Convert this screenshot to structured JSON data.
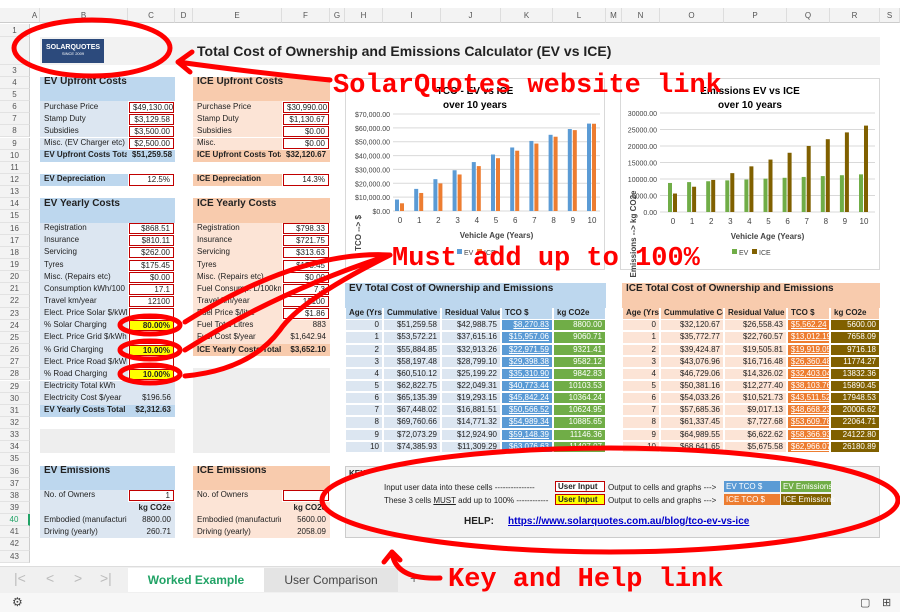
{
  "columns": [
    "A",
    "B",
    "C",
    "D",
    "E",
    "F",
    "G",
    "H",
    "I",
    "J",
    "K",
    "L",
    "M",
    "N",
    "O",
    "P",
    "Q",
    "R",
    "S"
  ],
  "logo": {
    "text": "SOLARQUOTES",
    "sub": "SINCE 2009"
  },
  "page_title": "Total Cost of Ownership and Emissions Calculator (EV vs ICE)",
  "colors": {
    "input_border": "#c00000",
    "must_sum": "#ffff00",
    "ev_tco": "#5b9bd5",
    "ev_emissions": "#70ad47",
    "ice_tco": "#ed7d31",
    "ice_emissions": "#806000",
    "ev_section": "#dce6f1",
    "ice_section": "#fce4d6",
    "annotation": "#ff0000"
  },
  "ev": {
    "upfront_title": "EV Upfront Costs",
    "upfront": [
      {
        "label": "Purchase Price",
        "value": "$49,130.00"
      },
      {
        "label": "Stamp Duty",
        "value": "$3,129.58"
      },
      {
        "label": "Subsidies",
        "value": "$3,500.00"
      },
      {
        "label": "Misc. (EV Charger etc)",
        "value": "$2,500.00"
      }
    ],
    "upfront_total": {
      "label": "EV Upfront Costs Total",
      "value": "$51,259.58"
    },
    "depreciation": {
      "label": "EV Depreciation",
      "value": "12.5%"
    },
    "yearly_title": "EV Yearly Costs",
    "yearly": [
      {
        "label": "Registration",
        "value": "$868.51",
        "t": "inp"
      },
      {
        "label": "Insurance",
        "value": "$810.11",
        "t": "inp"
      },
      {
        "label": "Servicing",
        "value": "$262.00",
        "t": "inp"
      },
      {
        "label": "Tyres",
        "value": "$175.45",
        "t": "inp"
      },
      {
        "label": "Misc. (Repairs etc)",
        "value": "$0.00",
        "t": "inp"
      },
      {
        "label": "Consumption kWh/100",
        "value": "17.1",
        "t": "inp"
      },
      {
        "label": "Travel km/year",
        "value": "12100",
        "t": "inp"
      },
      {
        "label": "Elect. Price Solar $/kWh",
        "value": "",
        "t": "inp"
      },
      {
        "label": "% Solar Charging",
        "value": "80.00%",
        "t": "yel"
      },
      {
        "label": "Elect. Price Grid $/kWh",
        "value": "",
        "t": "inp"
      },
      {
        "label": "% Grid Charging",
        "value": "10.00%",
        "t": "yel"
      },
      {
        "label": "Elect. Price Road $/kWh",
        "value": "",
        "t": "inp"
      },
      {
        "label": "% Road Charging",
        "value": "10.00%",
        "t": "yel"
      },
      {
        "label": "Electricity Total kWh",
        "value": "",
        "t": "out"
      },
      {
        "label": "Electricity Cost $/year",
        "value": "$196.56",
        "t": "out"
      }
    ],
    "yearly_total": {
      "label": "EV Yearly Costs Total",
      "value": "$2,312.63"
    },
    "emissions_title": "EV Emissions",
    "owners": {
      "label": "No. of Owners",
      "value": "1"
    },
    "unit": "kg CO2e",
    "emissions": [
      {
        "label": "Embodied (manufacturing)",
        "value": "8800.00"
      },
      {
        "label": "Driving (yearly)",
        "value": "260.71"
      }
    ]
  },
  "ice": {
    "upfront_title": "ICE Upfront Costs",
    "upfront": [
      {
        "label": "Purchase Price",
        "value": "$30,990.00"
      },
      {
        "label": "Stamp Duty",
        "value": "$1,130.67"
      },
      {
        "label": "Subsidies",
        "value": "$0.00"
      },
      {
        "label": "Misc.",
        "value": "$0.00"
      }
    ],
    "upfront_total": {
      "label": "ICE Upfront Costs Total",
      "value": "$32,120.67"
    },
    "depreciation": {
      "label": "ICE Depreciation",
      "value": "14.3%"
    },
    "yearly_title": "ICE Yearly Costs",
    "yearly": [
      {
        "label": "Registration",
        "value": "$798.33",
        "t": "inp"
      },
      {
        "label": "Insurance",
        "value": "$721.75",
        "t": "inp"
      },
      {
        "label": "Servicing",
        "value": "$313.63",
        "t": "inp"
      },
      {
        "label": "Tyres",
        "value": "$175.45",
        "t": "inp"
      },
      {
        "label": "Misc. (Repairs etc)",
        "value": "$0.00",
        "t": "inp"
      },
      {
        "label": "Fuel Consump. L/100km",
        "value": "7.3",
        "t": "inp"
      },
      {
        "label": "Travel km/year",
        "value": "12100",
        "t": "inp"
      },
      {
        "label": "Fuel Price $/litre",
        "value": "$1.86",
        "t": "inp"
      },
      {
        "label": "Fuel Total Litres",
        "value": "883",
        "t": "out"
      },
      {
        "label": "Fuel Cost $/year",
        "value": "$1,642.94",
        "t": "out"
      }
    ],
    "yearly_total": {
      "label": "ICE Yearly Costs Total",
      "value": "$3,652.10"
    },
    "emissions_title": "ICE Emissions",
    "owners": {
      "label": "No. of Owners",
      "value": ""
    },
    "unit": "kg CO2e",
    "emissions": [
      {
        "label": "Embodied (manufacturing)",
        "value": "5600.00"
      },
      {
        "label": "Driving (yearly)",
        "value": "2058.09"
      }
    ]
  },
  "ev_table": {
    "title": "EV Total Cost of Ownership and Emissions",
    "headers": [
      "Age (Yrs)",
      "Cummulative Cost",
      "Residual Value",
      "TCO $",
      "kg CO2e"
    ],
    "rows": [
      [
        "0",
        "$51,259.58",
        "$42,988.75",
        "$8,270.83",
        "8800.00"
      ],
      [
        "1",
        "$53,572.21",
        "$37,615.16",
        "$15,957.06",
        "9060.71"
      ],
      [
        "2",
        "$55,884.85",
        "$32,913.26",
        "$22,971.59",
        "9321.41"
      ],
      [
        "3",
        "$58,197.48",
        "$28,799.10",
        "$29,398.38",
        "9582.12"
      ],
      [
        "4",
        "$60,510.12",
        "$25,199.22",
        "$35,310.90",
        "9842.83"
      ],
      [
        "5",
        "$62,822.75",
        "$22,049.31",
        "$40,773.44",
        "10103.53"
      ],
      [
        "6",
        "$65,135.39",
        "$19,293.15",
        "$45,842.24",
        "10364.24"
      ],
      [
        "7",
        "$67,448.02",
        "$16,881.51",
        "$50,566.52",
        "10624.95"
      ],
      [
        "8",
        "$69,760.66",
        "$14,771.32",
        "$54,989.34",
        "10885.65"
      ],
      [
        "9",
        "$72,073.29",
        "$12,924.90",
        "$59,148.39",
        "11146.36"
      ],
      [
        "10",
        "$74,385.93",
        "$11,309.29",
        "$63,076.63",
        "11407.07"
      ]
    ]
  },
  "ice_table": {
    "title": "ICE Total Cost of Ownership and Emissions",
    "headers": [
      "Age (Yrs)",
      "Cummulative Cost",
      "Residual Value",
      "TCO $",
      "kg CO2e"
    ],
    "rows": [
      [
        "0",
        "$32,120.67",
        "$26,558.43",
        "$5,562.24",
        "5600.00"
      ],
      [
        "1",
        "$35,772.77",
        "$22,760.57",
        "$13,012.19",
        "7658.09"
      ],
      [
        "2",
        "$39,424.87",
        "$19,505.81",
        "$19,919.05",
        "9716.18"
      ],
      [
        "3",
        "$43,076.96",
        "$16,716.48",
        "$26,360.48",
        "11774.27"
      ],
      [
        "4",
        "$46,729.06",
        "$14,326.02",
        "$32,403.04",
        "13832.36"
      ],
      [
        "5",
        "$50,381.16",
        "$12,277.40",
        "$38,103.76",
        "15890.45"
      ],
      [
        "6",
        "$54,033.26",
        "$10,521.73",
        "$43,511.52",
        "17948.53"
      ],
      [
        "7",
        "$57,685.36",
        "$9,017.13",
        "$48,668.23",
        "20006.62"
      ],
      [
        "8",
        "$61,337.45",
        "$7,727.68",
        "$53,609.78",
        "22064.71"
      ],
      [
        "9",
        "$64,989.55",
        "$6,622.62",
        "$58,366.93",
        "24122.80"
      ],
      [
        "10",
        "$68,641.65",
        "$5,675.58",
        "$62,966.07",
        "26180.89"
      ]
    ]
  },
  "chart_data": [
    {
      "type": "bar",
      "title": "TCO - EV vs ICE",
      "subtitle": "over 10 years",
      "xlabel": "Vehicle Age (Years)",
      "ylabel": "TCO --> $",
      "categories": [
        "0",
        "1",
        "2",
        "3",
        "4",
        "5",
        "6",
        "7",
        "8",
        "9",
        "10"
      ],
      "ylim": [
        0,
        70000
      ],
      "yticks": [
        "$0.00",
        "$10,000.00",
        "$20,000.00",
        "$30,000.00",
        "$40,000.00",
        "$50,000.00",
        "$60,000.00",
        "$70,000.00"
      ],
      "grid": true,
      "legend": "bottom",
      "series": [
        {
          "name": "EV",
          "color": "#5b9bd5",
          "values": [
            8270.83,
            15957.06,
            22971.59,
            29398.38,
            35310.9,
            40773.44,
            45842.24,
            50566.52,
            54989.34,
            59148.39,
            63076.63
          ]
        },
        {
          "name": "ICE",
          "color": "#ed7d31",
          "values": [
            5562.24,
            13012.19,
            19919.05,
            26360.48,
            32403.04,
            38103.76,
            43511.52,
            48668.23,
            53609.78,
            58366.93,
            62966.07
          ]
        }
      ]
    },
    {
      "type": "bar",
      "title": "Emissions EV vs ICE",
      "subtitle": "over 10 years",
      "xlabel": "Vehicle Age (Years)",
      "ylabel": "Emissions --> kg CO2e",
      "categories": [
        "0",
        "1",
        "2",
        "3",
        "4",
        "5",
        "6",
        "7",
        "8",
        "9",
        "10"
      ],
      "ylim": [
        0,
        30000
      ],
      "yticks": [
        "0.00",
        "5000.00",
        "10000.00",
        "15000.00",
        "20000.00",
        "25000.00",
        "30000.00"
      ],
      "grid": true,
      "legend": "bottom",
      "series": [
        {
          "name": "EV",
          "color": "#70ad47",
          "values": [
            8800.0,
            9060.71,
            9321.41,
            9582.12,
            9842.83,
            10103.53,
            10364.24,
            10624.95,
            10885.65,
            11146.36,
            11407.07
          ]
        },
        {
          "name": "ICE",
          "color": "#806000",
          "values": [
            5600.0,
            7658.09,
            9716.18,
            11774.27,
            13832.36,
            15890.45,
            17948.53,
            20006.62,
            22064.71,
            24122.8,
            26180.89
          ]
        }
      ]
    }
  ],
  "key": {
    "title": "KEY",
    "line1": "Input user data into these cells ---------------",
    "line2_pre": "These 3 cells ",
    "line2_must": "MUST",
    "line2_post": " add up to 100% ------------",
    "user_input": "User Input",
    "output": "Output to cells and graphs --->",
    "ev_tco": "EV TCO $",
    "ev_em": "EV Emissions",
    "ice_tco": "ICE TCO $",
    "ice_em": "ICE Emissions",
    "help_label": "HELP:",
    "help_link": "https://www.solarquotes.com.au/blog/tco-ev-vs-ice"
  },
  "sheets": [
    {
      "label": "Worked Example",
      "active": true
    },
    {
      "label": "User Comparison",
      "active": false
    }
  ],
  "annotations": {
    "logo": "SolarQuotes website link",
    "sum": "Must add up to 100%",
    "key": "Key and Help link"
  }
}
